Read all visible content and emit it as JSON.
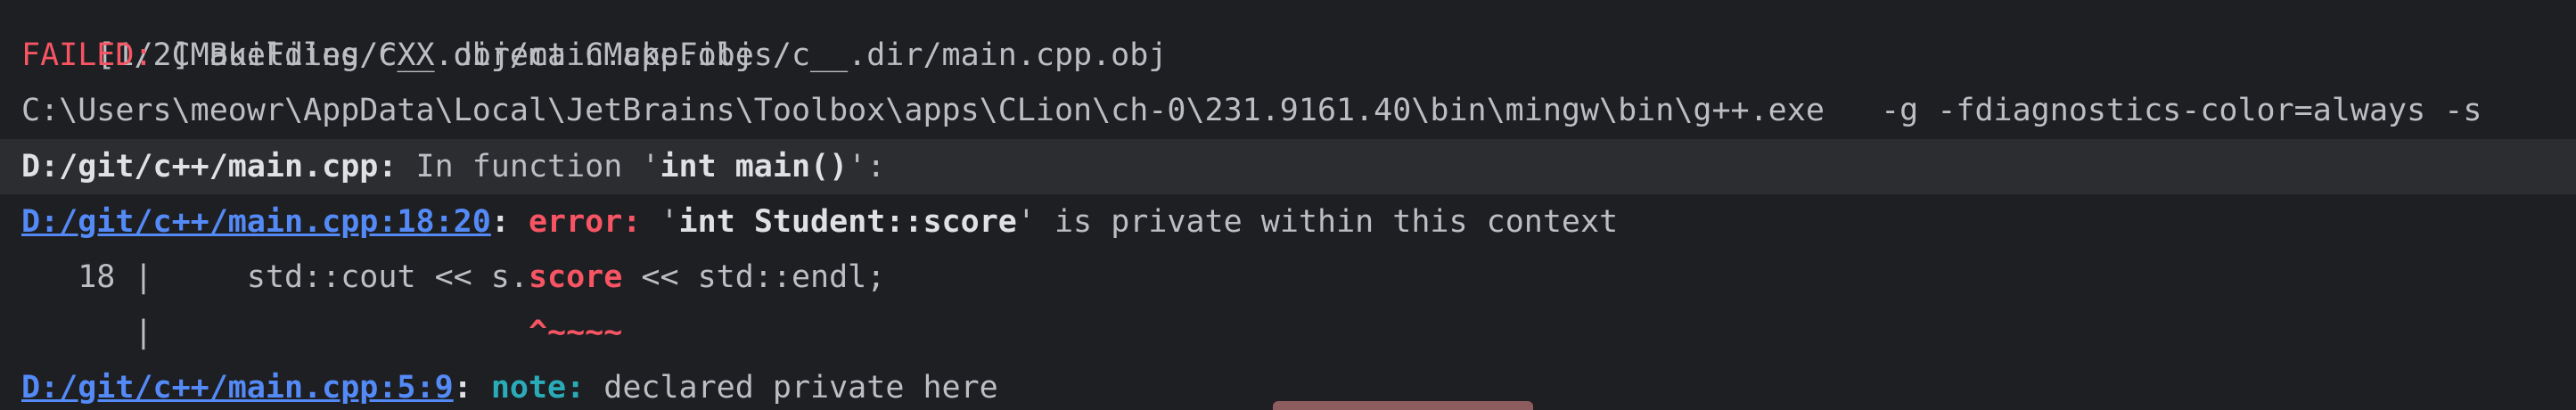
{
  "build_output": {
    "step_line": "[1/2] Building CXX object CMakeFiles/c__.dir/main.cpp.obj",
    "failed_label": "FAILED:",
    "failed_target": "CMakeFiles/c__.dir/main.cpp.obj",
    "compile_command": "C:\\Users\\meowr\\AppData\\Local\\JetBrains\\Toolbox\\apps\\CLion\\ch-0\\231.9161.40\\bin\\mingw\\bin\\g++.exe   -g -fdiagnostics-color=always -s",
    "in_function": {
      "file": "D:/git/c++/main.cpp:",
      "text_before": " In function '",
      "function": "int main()",
      "text_after": "':"
    },
    "error": {
      "location": "D:/git/c++/main.cpp:18:20",
      "colon": ":",
      "label": "error:",
      "quote_open": " '",
      "symbol": "int Student::score",
      "message": "' is private within this context"
    },
    "source_line": {
      "line_number": "   18 |     ",
      "code_before": "std::cout << s.",
      "highlight": "score",
      "code_after": " << std::endl;"
    },
    "caret_line": {
      "gutter": "      |                    ",
      "marker": "^~~~~"
    },
    "note": {
      "location": "D:/git/c++/main.cpp:5:9",
      "colon": ":",
      "label": "note:",
      "message": " declared private here"
    }
  },
  "colors": {
    "background": "#1e1f22",
    "text": "#bcbec4",
    "error": "#f75464",
    "link": "#548af7",
    "note": "#2aacb8",
    "highlight_row": "#2b2d30"
  }
}
